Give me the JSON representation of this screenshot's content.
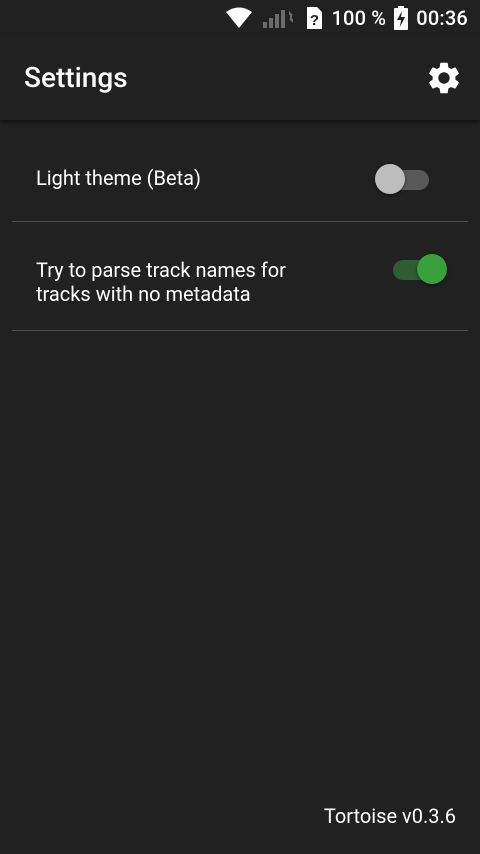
{
  "status_bar": {
    "battery_percent": "100 %",
    "time": "00:36",
    "icons": [
      "wifi-icon",
      "signal-bars-icon",
      "unknown-sim-icon",
      "battery-charging-icon"
    ]
  },
  "app_bar": {
    "title": "Settings",
    "action_icon": "gear-icon"
  },
  "preferences": [
    {
      "label": "Light theme (Beta)",
      "enabled": false
    },
    {
      "label": "Try to parse track names for tracks with no metadata",
      "enabled": true
    }
  ],
  "footer": {
    "version": "Tortoise v0.3.6"
  },
  "colors": {
    "background": "#212121",
    "switch_on_thumb": "#36a03c",
    "switch_on_track": "#2f5c31",
    "switch_off_thumb": "#bdbdbd",
    "switch_off_track": "#595959",
    "divider": "#4a4a4a"
  }
}
